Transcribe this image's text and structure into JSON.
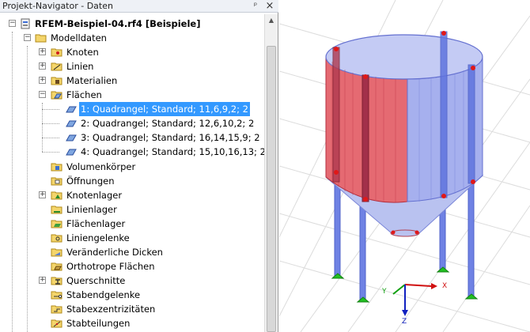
{
  "panel": {
    "title": "Projekt-Navigator - Daten",
    "pin": "ᵖ",
    "close": "×"
  },
  "tree": {
    "root": "RFEM-Beispiel-04.rf4 [Beispiele]",
    "modelldaten": "Modelldaten",
    "knoten": "Knoten",
    "linien": "Linien",
    "materialien": "Materialien",
    "flaechen": "Flächen",
    "flaechen_items": [
      "1: Quadrangel; Standard; 11,6,9,2; 2",
      "2: Quadrangel; Standard; 12,6,10,2; 2",
      "3: Quadrangel; Standard; 16,14,15,9; 2",
      "4: Quadrangel; Standard; 15,10,16,13; 2"
    ],
    "volumenkoerper": "Volumenkörper",
    "oeffnungen": "Öffnungen",
    "knotenlager": "Knotenlager",
    "linienlager": "Linienlager",
    "flaechenlager": "Flächenlager",
    "liniengelenke": "Liniengelenke",
    "veraenderliche_dicken": "Veränderliche Dicken",
    "orthotrope_flaechen": "Orthotrope Flächen",
    "querschnitte": "Querschnitte",
    "stabendgelenke": "Stabendgelenke",
    "stabexzentrizitaeten": "Stabexzentrizitäten",
    "stabteilungen": "Stabteilungen"
  },
  "view": {
    "axis_x": "X",
    "axis_y": "Y",
    "axis_z": "Z"
  },
  "colors": {
    "selection": "#3399ff",
    "surface_red": "#e0505a",
    "surface_blue": "#8c98e8",
    "columns": "#6a7de0",
    "support_green": "#22c022",
    "axis_red": "#d01010",
    "axis_green": "#10a010",
    "axis_blue": "#1020c0"
  }
}
